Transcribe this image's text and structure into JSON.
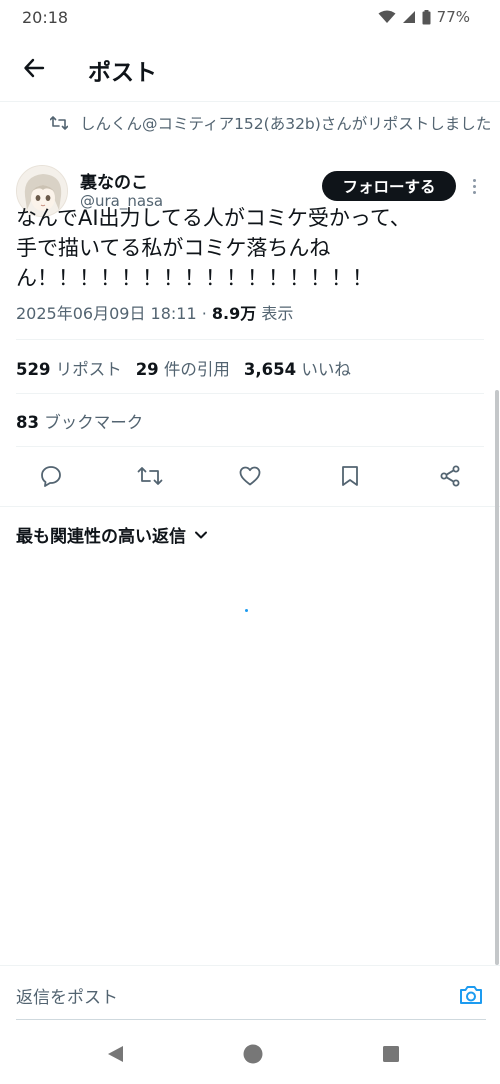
{
  "status_bar": {
    "time": "20:18",
    "battery": "77%"
  },
  "header": {
    "title": "ポスト"
  },
  "repost": {
    "text": "しんくん@コミティア152(あ32b)さんがリポストしました"
  },
  "author": {
    "name": "裏なのこ",
    "handle": "@ura_nasa"
  },
  "follow_button": {
    "label": "フォローする"
  },
  "tweet": {
    "text": "なんでAI出力してる人がコミケ受かって、手で描いてる私がコミケ落ちんねん！！！！！！！！！！！！！！！！",
    "datetime": "2025年06月09日 18:11",
    "separator": " · ",
    "views": "8.9万",
    "views_label": " 表示"
  },
  "stats": {
    "reposts": "529",
    "reposts_label": " リポスト",
    "quotes": "29",
    "quotes_label": " 件の引用",
    "likes": "3,654",
    "likes_label": " いいね",
    "bookmarks": "83",
    "bookmarks_label": " ブックマーク"
  },
  "actions": [
    {
      "icon": "reply-icon"
    },
    {
      "icon": "retweet-icon"
    },
    {
      "icon": "heart-icon"
    },
    {
      "icon": "bookmark-icon"
    },
    {
      "icon": "share-icon"
    }
  ],
  "replies": {
    "sort_label": "最も関連性の高い返信"
  },
  "reply_box": {
    "placeholder": "返信をポスト"
  },
  "colors": {
    "accent": "#1d9bf0",
    "text": "#0f1419",
    "secondary": "#536471",
    "divider": "#eff3f4"
  }
}
